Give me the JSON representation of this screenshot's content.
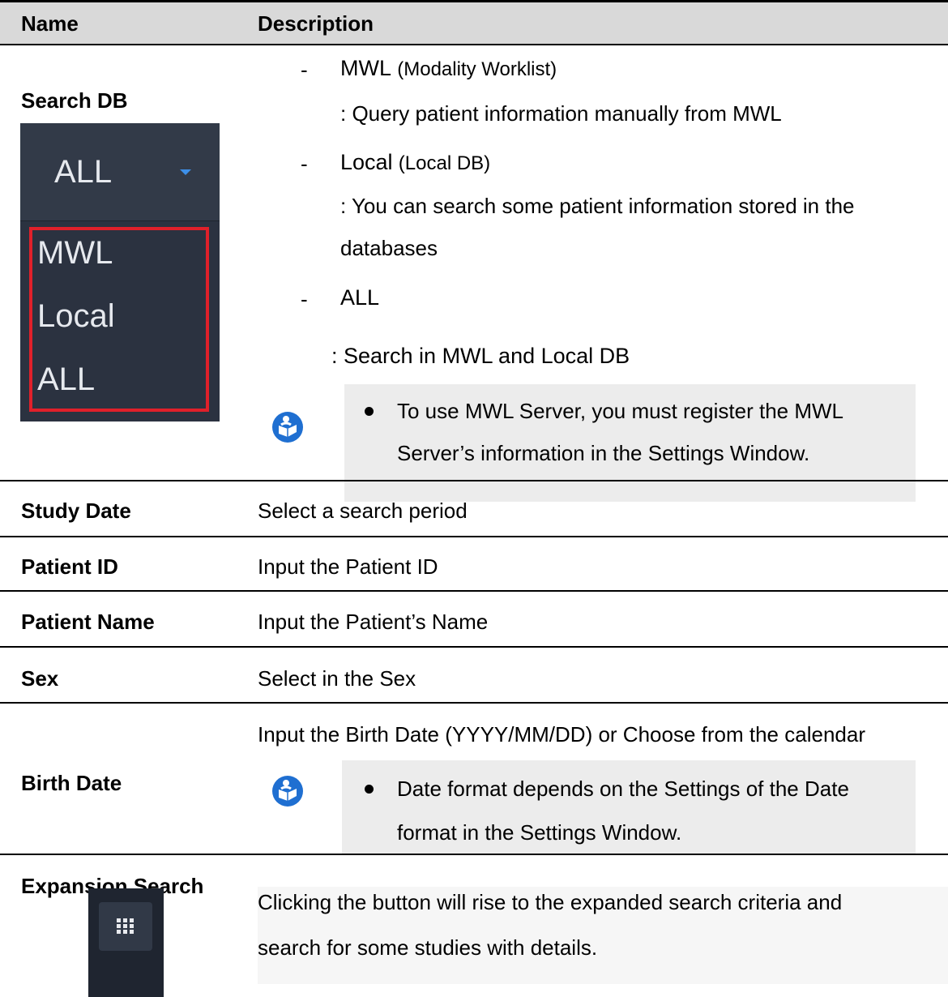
{
  "header": {
    "col_name": "Name",
    "col_description": "Description"
  },
  "search_db": {
    "name": "Search DB",
    "dropdown": {
      "selected": "ALL",
      "options": [
        "MWL",
        "Local",
        "ALL"
      ]
    },
    "items": [
      {
        "dash": "-",
        "title": "MWL",
        "title_note": "(Modality Worklist)",
        "desc": ": Query patient information manually from MWL"
      },
      {
        "dash": "-",
        "title": "Local",
        "title_note": "(Local DB)",
        "desc_line1": ": You can search some patient information stored in the",
        "desc_line2": "databases"
      },
      {
        "dash": "-",
        "title": "ALL",
        "desc": ": Search in MWL and Local DB"
      }
    ],
    "note_line1": "To use MWL Server, you must register the MWL",
    "note_line2": "Server’s information in the Settings Window."
  },
  "rows": [
    {
      "name": "Study Date",
      "desc": "Select a search period"
    },
    {
      "name": "Patient ID",
      "desc": "Input the Patient ID"
    },
    {
      "name": "Patient Name",
      "desc": "Input the Patient’s Name"
    },
    {
      "name": "Sex",
      "desc": "Select in the Sex"
    }
  ],
  "birth_date": {
    "name": "Birth Date",
    "desc": "Input the Birth Date (YYYY/MM/DD) or Choose from the calendar",
    "note_line1": "Date format depends on the Settings of the Date",
    "note_line2": "format in the Settings Window."
  },
  "expansion": {
    "name": "Expansion Search",
    "desc_line1": "Clicking the button will rise to the expanded search criteria and",
    "desc_line2": "search for some studies with details.",
    "button_icon": "grid-icon"
  },
  "colors": {
    "header_bg": "#d9d9d9",
    "note_bg": "#ececec",
    "dropdown_bg": "#2b3240",
    "highlight": "#e0202a",
    "icon_blue": "#1f6fd1"
  }
}
